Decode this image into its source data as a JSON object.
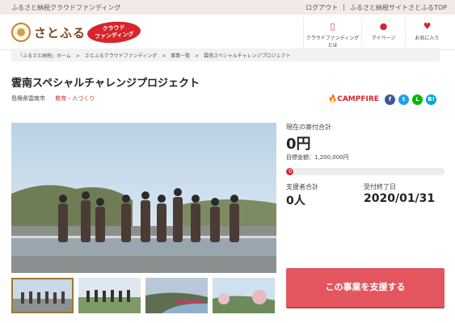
{
  "topbar": {
    "tagline": "ふるさと納税クラウドファンディング",
    "links": [
      "ログアウト",
      "|",
      "ふるさと納税サイトさとふるTOP"
    ]
  },
  "header": {
    "logo_text": "さとふる",
    "badge_line1": "クラウド",
    "badge_line2": "ファンディング",
    "nav": [
      {
        "icon": "book-icon",
        "glyph": "▯",
        "label": "クラウドファンディングとは"
      },
      {
        "icon": "user-icon",
        "glyph": "●",
        "label": "マイページ"
      },
      {
        "icon": "heart-icon",
        "glyph": "♥",
        "label": "お気に入り"
      }
    ],
    "accent": "#d8242c"
  },
  "breadcrumb": [
    "「ふるさと納税」ホーム",
    ">",
    "さとふるクラウドファンディング",
    ">",
    "事業一覧",
    ">",
    "雲南スペシャルチャレンジプロジェクト"
  ],
  "project": {
    "title": "雲南スペシャルチャレンジプロジェクト",
    "location": "島根県雲南市",
    "category": "教育・人づくり",
    "partner": "CAMPFIRE",
    "share": [
      "f",
      "t",
      "L",
      "B!"
    ]
  },
  "stats": {
    "current_label": "現在の寄付合計",
    "current_amount": "0円",
    "goal_text": "目標金額：1,200,000円",
    "progress_percent": 0,
    "progress_text": "0%",
    "supporters_label": "支援者合計",
    "supporters_value": "0人",
    "end_label": "受付終了日",
    "end_date": "2020/01/31"
  },
  "cta_label": "この事業を支援する"
}
